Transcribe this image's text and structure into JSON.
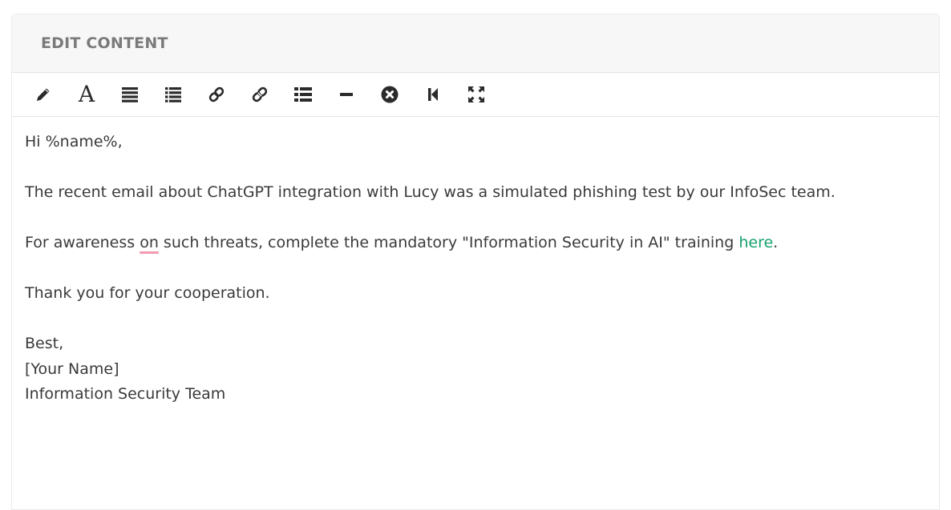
{
  "panel": {
    "title": "EDIT CONTENT"
  },
  "toolbar": {
    "buttons": [
      {
        "name": "pencil-icon"
      },
      {
        "name": "font-icon"
      },
      {
        "name": "align-justify-icon"
      },
      {
        "name": "list-icon"
      },
      {
        "name": "link-icon"
      },
      {
        "name": "unlink-icon"
      },
      {
        "name": "list-ul-icon"
      },
      {
        "name": "horizontal-rule-icon"
      },
      {
        "name": "remove-format-icon"
      },
      {
        "name": "step-backward-icon"
      },
      {
        "name": "fullscreen-icon"
      }
    ]
  },
  "email": {
    "greeting": "Hi %name%,",
    "line1": "The recent email about ChatGPT integration with Lucy was a simulated phishing test by our InfoSec team.",
    "line2_before": "For awareness ",
    "line2_spell": "on",
    "line2_middle": " such threats, complete the mandatory \"Information Security in AI\" training ",
    "line2_link": "here",
    "line2_end": ".",
    "thanks": "Thank you for your cooperation.",
    "signoff": "Best,",
    "sender_name": "[Your Name]",
    "sender_team": "Information Security Team"
  },
  "colors": {
    "link": "#17a16c",
    "spellcheck_underline": "#f29bb0",
    "header_bg": "#f7f7f7"
  }
}
